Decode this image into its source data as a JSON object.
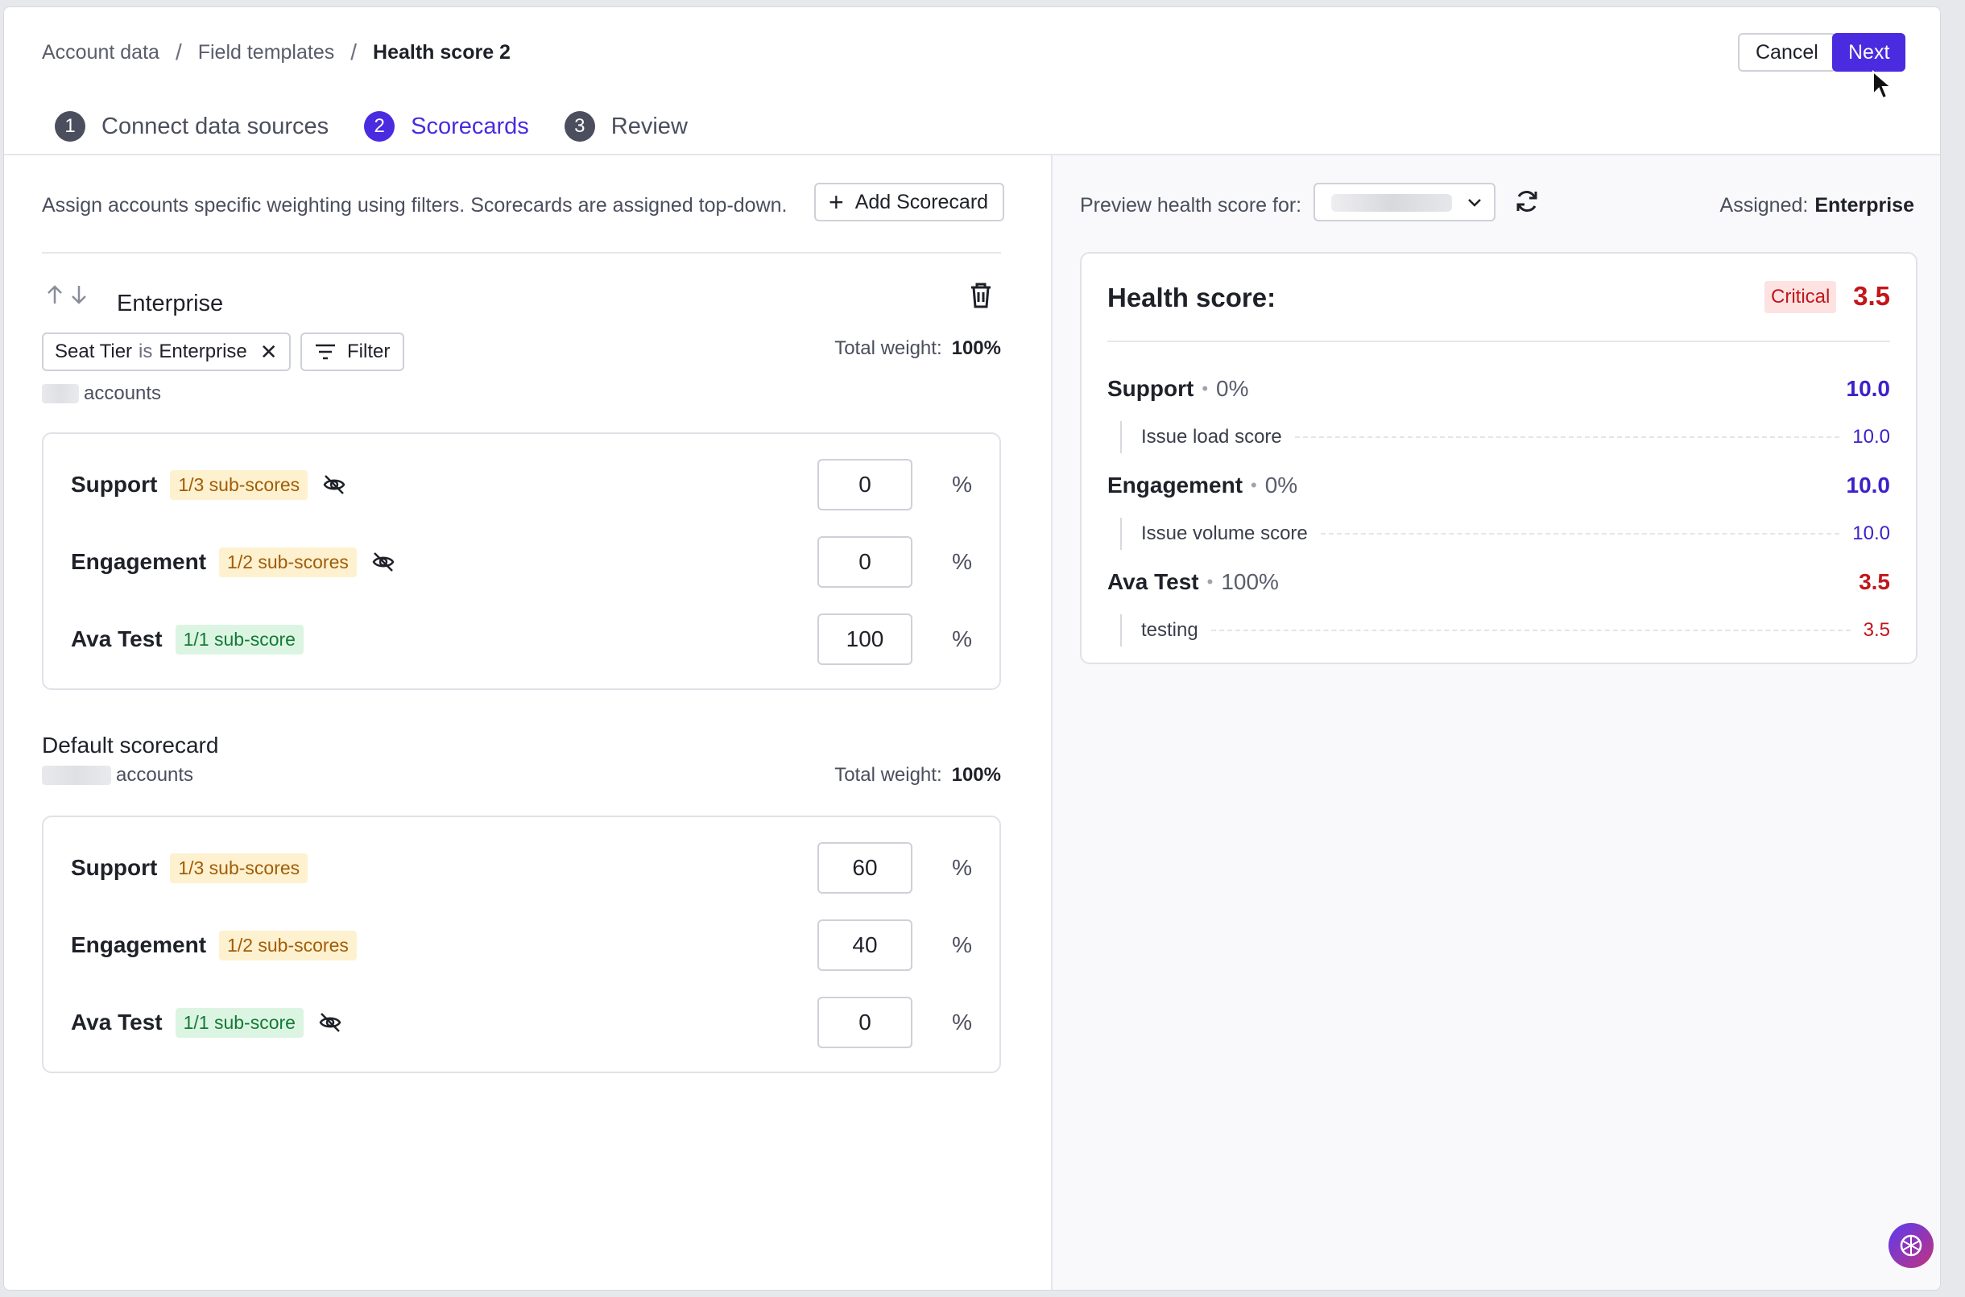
{
  "breadcrumb": {
    "items": [
      "Account data",
      "Field templates"
    ],
    "current": "Health score 2",
    "separator": "/"
  },
  "actions": {
    "cancel": "Cancel",
    "next": "Next"
  },
  "steps": [
    {
      "num": "1",
      "label": "Connect data sources"
    },
    {
      "num": "2",
      "label": "Scorecards"
    },
    {
      "num": "3",
      "label": "Review"
    }
  ],
  "left": {
    "description": "Assign accounts specific weighting using filters. Scorecards are assigned top-down.",
    "add_scorecard": "Add Scorecard",
    "enterprise": {
      "title": "Enterprise",
      "filter_chip": {
        "field": "Seat Tier",
        "op": "is",
        "value": "Enterprise"
      },
      "filter_button": "Filter",
      "total_weight_label": "Total weight:",
      "total_weight_value": "100%",
      "accounts_label": "accounts",
      "rows": [
        {
          "name": "Support",
          "badge": "1/3 sub-scores",
          "weight": "0"
        },
        {
          "name": "Engagement",
          "badge": "1/2 sub-scores",
          "weight": "0"
        },
        {
          "name": "Ava Test",
          "badge": "1/1 sub-score",
          "weight": "100"
        }
      ]
    },
    "default": {
      "title": "Default scorecard",
      "total_weight_label": "Total weight:",
      "total_weight_value": "100%",
      "accounts_label": "accounts",
      "rows": [
        {
          "name": "Support",
          "badge": "1/3 sub-scores",
          "weight": "60"
        },
        {
          "name": "Engagement",
          "badge": "1/2 sub-scores",
          "weight": "40"
        },
        {
          "name": "Ava Test",
          "badge": "1/1 sub-score",
          "weight": "0"
        }
      ]
    },
    "percent": "%"
  },
  "right": {
    "preview_label": "Preview health score for:",
    "assigned_label": "Assigned:",
    "assigned_value": "Enterprise",
    "health": {
      "title": "Health score:",
      "status": "Critical",
      "value": "3.5",
      "categories": [
        {
          "name": "Support",
          "weight": "0%",
          "score": "10.0",
          "sub_name": "Issue load score",
          "sub_score": "10.0"
        },
        {
          "name": "Engagement",
          "weight": "0%",
          "score": "10.0",
          "sub_name": "Issue volume score",
          "sub_score": "10.0"
        },
        {
          "name": "Ava Test",
          "weight": "100%",
          "score": "3.5",
          "sub_name": "testing",
          "sub_score": "3.5"
        }
      ]
    }
  },
  "colors": {
    "accent": "#4a2be0",
    "critical": "#c2161a",
    "warn_badge": "#fdf1cf",
    "ok_badge": "#dcf5e3"
  },
  "icons": [
    "arrow-up-icon",
    "arrow-down-icon",
    "trash-icon",
    "close-icon",
    "filter-icon",
    "eye-off-icon",
    "chevron-down-icon",
    "refresh-icon",
    "plus-icon",
    "cursor-icon",
    "assistant-icon"
  ]
}
